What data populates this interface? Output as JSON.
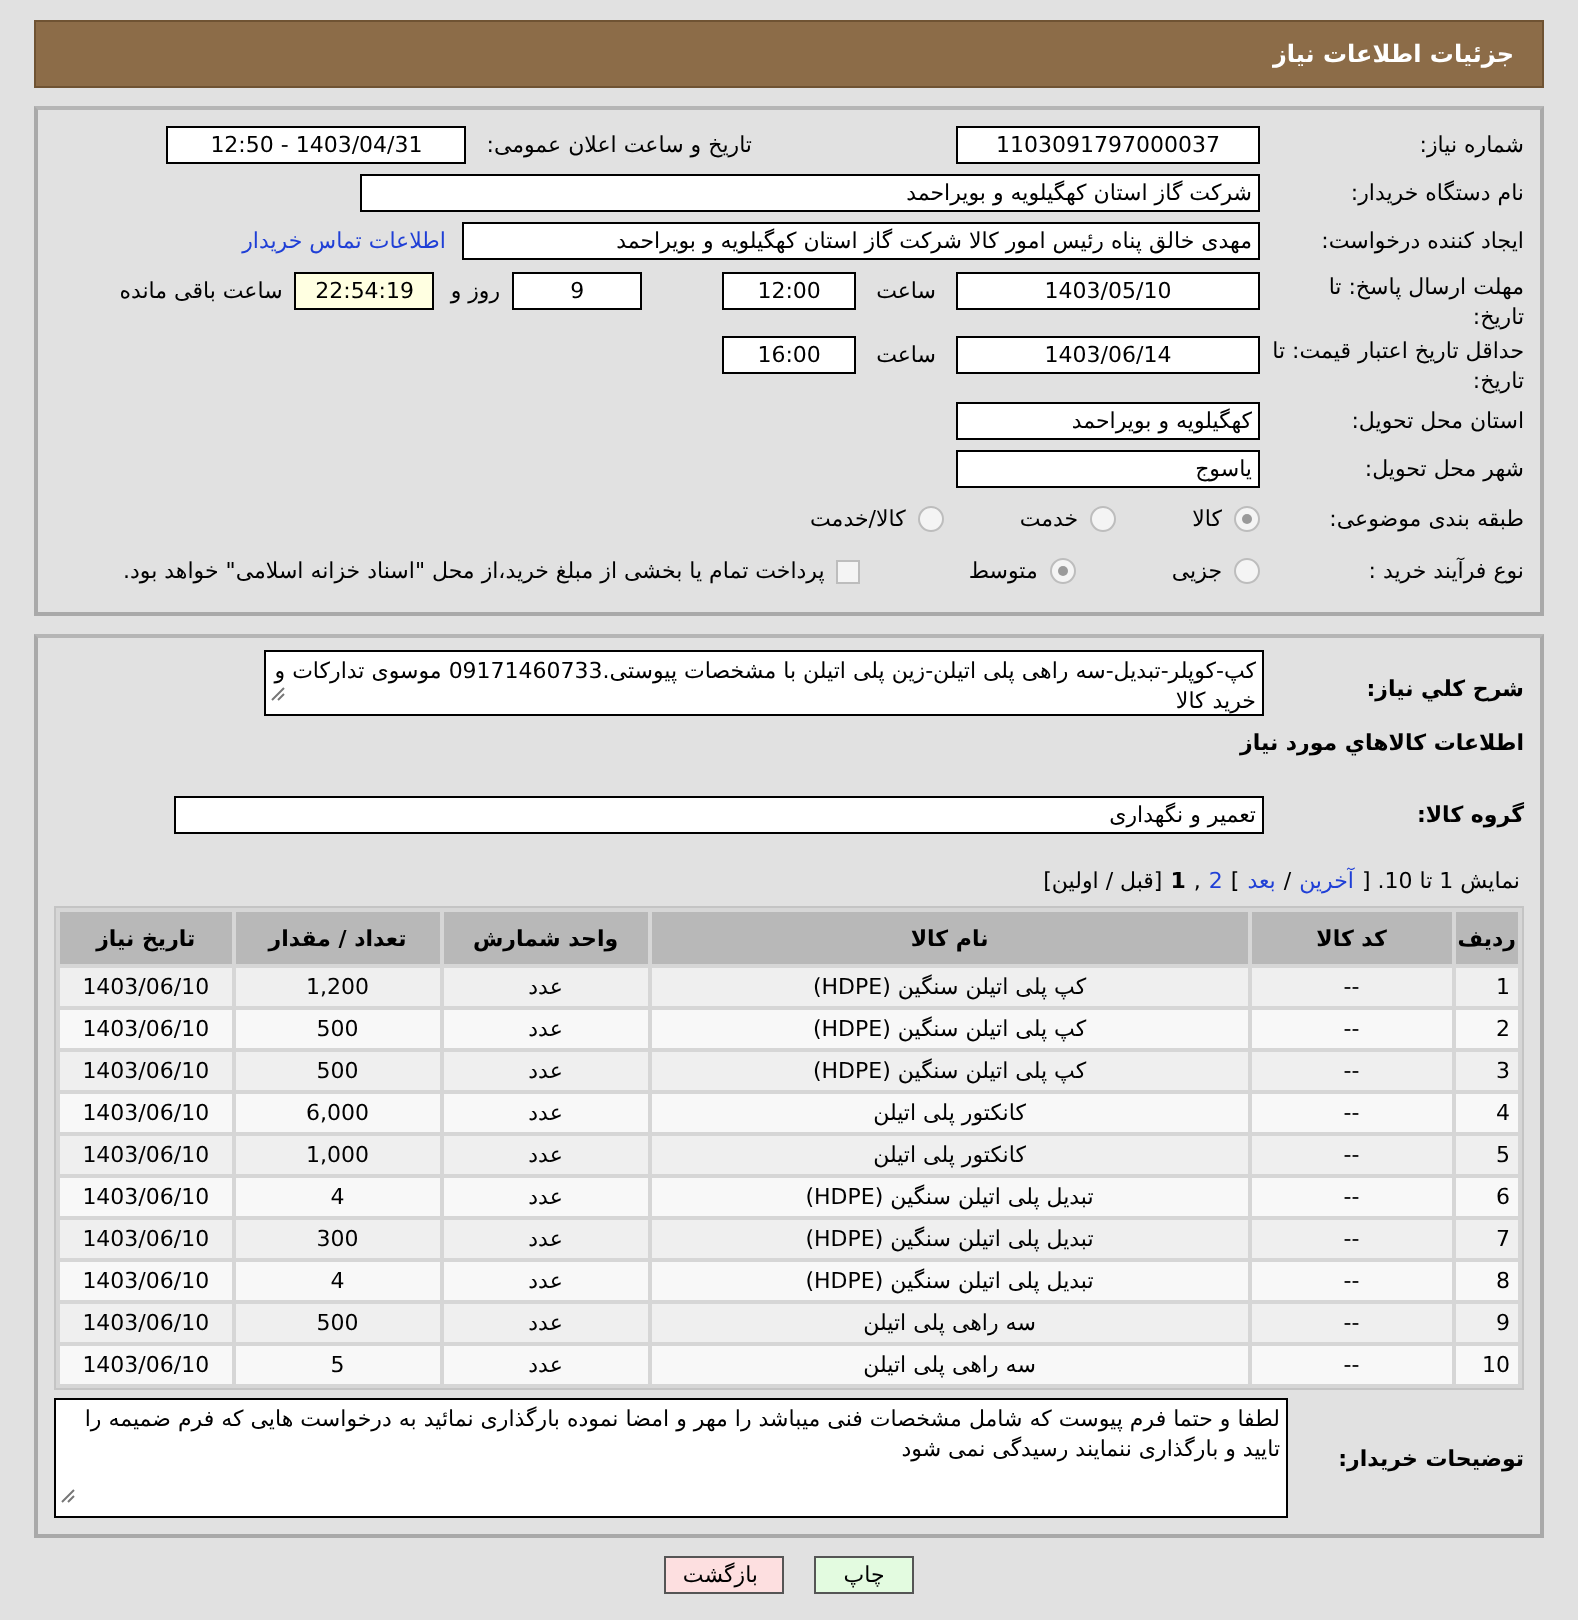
{
  "header": {
    "title": "جزئیات اطلاعات نیاز"
  },
  "details": {
    "need_number": {
      "label": "شماره نیاز:",
      "value": "1103091797000037"
    },
    "announce": {
      "label": "تاریخ و ساعت اعلان عمومی:",
      "value": "1403/04/31 - 12:50"
    },
    "buyer": {
      "label": "نام دستگاه خریدار:",
      "value": "شرکت گاز استان کهگیلویه و بویراحمد"
    },
    "requester": {
      "label": "ایجاد کننده درخواست:",
      "value": "مهدی خالق پناه رئیس امور کالا شرکت گاز استان کهگیلویه و بویراحمد",
      "link": "اطلاعات تماس خریدار"
    },
    "deadline": {
      "label": "مهلت ارسال پاسخ: تا تاریخ:",
      "date": "1403/05/10",
      "time_label": "ساعت",
      "time": "12:00",
      "days": "9",
      "days_label": "روز و",
      "remaining": "22:54:19",
      "remaining_label": "ساعت باقی مانده"
    },
    "validity": {
      "label": "حداقل تاریخ اعتبار قیمت: تا تاریخ:",
      "date": "1403/06/14",
      "time_label": "ساعت",
      "time": "16:00"
    },
    "province": {
      "label": "استان محل تحویل:",
      "value": "کهگیلویه و بویراحمد"
    },
    "city": {
      "label": "شهر محل تحویل:",
      "value": "یاسوج"
    },
    "category": {
      "label": "طبقه بندی موضوعی:",
      "options": [
        {
          "label": "کالا",
          "selected": true
        },
        {
          "label": "خدمت",
          "selected": false
        },
        {
          "label": "کالا/خدمت",
          "selected": false
        }
      ]
    },
    "process": {
      "label": "نوع فرآیند خرید :",
      "options": [
        {
          "label": "جزیی",
          "selected": false
        },
        {
          "label": "متوسط",
          "selected": true
        }
      ],
      "payment": {
        "label": "پرداخت تمام یا بخشی از مبلغ خرید،از محل \"اسناد خزانه اسلامی\" خواهد بود.",
        "checked": false
      }
    }
  },
  "items": {
    "description": {
      "label": "شرح كلي نياز:",
      "value": "کپ-کوپلر-تبدیل-سه راهی پلی اتیلن-زین پلی اتیلن با مشخصات پیوستی.09171460733 موسوی تدارکات و خرید کالا"
    },
    "heading": "اطلاعات كالاهاي مورد نياز",
    "group": {
      "label": "گروه كالا:",
      "value": "تعمیر و نگهداری"
    },
    "pagination": [
      {
        "text": "نمایش 1 تا 10. [",
        "kind": "text"
      },
      {
        "text": "آخرین",
        "kind": "link"
      },
      {
        "text": "/",
        "kind": "text"
      },
      {
        "text": "بعد",
        "kind": "link"
      },
      {
        "text": "]",
        "kind": "text"
      },
      {
        "text": "2",
        "kind": "page",
        "selected": false
      },
      {
        "text": ",",
        "kind": "text"
      },
      {
        "text": "1",
        "kind": "page",
        "selected": true
      },
      {
        "text": "[قبل / اولین]",
        "kind": "text"
      }
    ],
    "table": {
      "columns": [
        "ردیف",
        "کد کالا",
        "نام کالا",
        "واحد شمارش",
        "تعداد / مقدار",
        "تاریخ نیاز"
      ],
      "rows": [
        [
          "1",
          "--",
          "کپ پلی اتیلن سنگین (HDPE)",
          "عدد",
          "1,200",
          "1403/06/10"
        ],
        [
          "2",
          "--",
          "کپ پلی اتیلن سنگین (HDPE)",
          "عدد",
          "500",
          "1403/06/10"
        ],
        [
          "3",
          "--",
          "کپ پلی اتیلن سنگین (HDPE)",
          "عدد",
          "500",
          "1403/06/10"
        ],
        [
          "4",
          "--",
          "کانکتور پلی اتیلن",
          "عدد",
          "6,000",
          "1403/06/10"
        ],
        [
          "5",
          "--",
          "کانکتور پلی اتیلن",
          "عدد",
          "1,000",
          "1403/06/10"
        ],
        [
          "6",
          "--",
          "تبدیل پلی اتیلن سنگین (HDPE)",
          "عدد",
          "4",
          "1403/06/10"
        ],
        [
          "7",
          "--",
          "تبدیل پلی اتیلن سنگین (HDPE)",
          "عدد",
          "300",
          "1403/06/10"
        ],
        [
          "8",
          "--",
          "تبدیل پلی اتیلن سنگین (HDPE)",
          "عدد",
          "4",
          "1403/06/10"
        ],
        [
          "9",
          "--",
          "سه راهی پلی اتیلن",
          "عدد",
          "500",
          "1403/06/10"
        ],
        [
          "10",
          "--",
          "سه راهی پلی اتیلن",
          "عدد",
          "5",
          "1403/06/10"
        ]
      ]
    },
    "notes": {
      "label": "توضیحات خریدار:",
      "value": "لطفا و حتما فرم پیوست که شامل مشخصات فنی میباشد را مهر و امضا نموده بارگذاری نمائید به درخواست هایی که فرم ضمیمه را تایید و بارگذاری ننمایند رسیدگی نمی شود"
    }
  },
  "buttons": [
    {
      "label": "چاپ",
      "kind": "print"
    },
    {
      "label": "بازگشت",
      "kind": "back"
    }
  ]
}
